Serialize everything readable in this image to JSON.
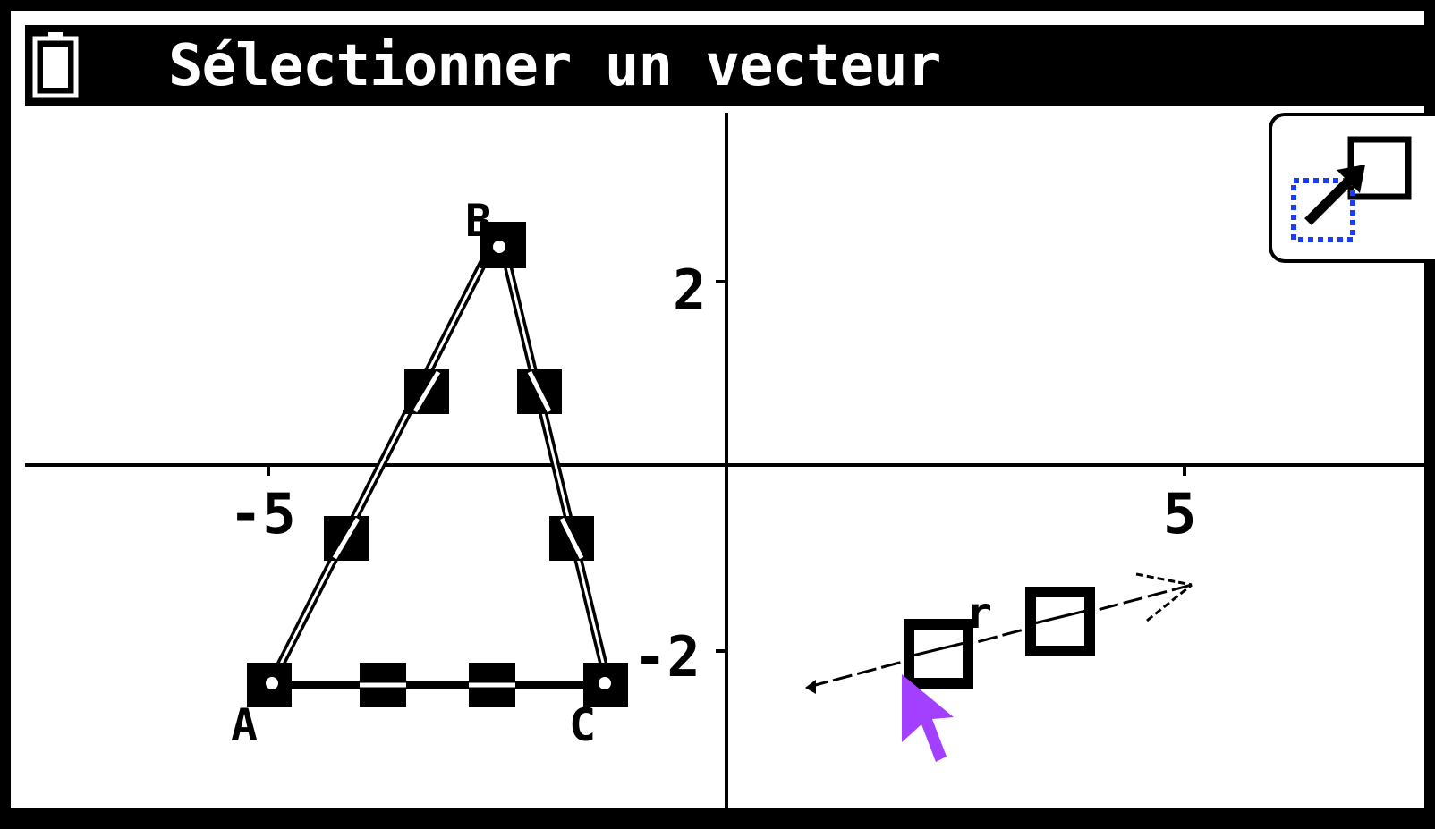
{
  "header": {
    "title": "Sélectionner un vecteur",
    "battery_icon": "battery-icon"
  },
  "graph": {
    "x_tick_labels": [
      "-5",
      "5"
    ],
    "y_tick_labels": [
      "2",
      "-2"
    ],
    "points": {
      "A": {
        "label": "A",
        "x": -5,
        "y": -2.4
      },
      "B": {
        "label": "B",
        "x": -2.6,
        "y": 2.3
      },
      "C": {
        "label": "C",
        "x": -1.3,
        "y": -2.4
      }
    },
    "vector": {
      "start": {
        "x": 1.0,
        "y": -2.4
      },
      "end": {
        "x": 5.1,
        "y": -1.3
      },
      "label": "r"
    },
    "pointer_icon": "cursor-arrow-icon"
  },
  "toolbar": {
    "tool_icon": "vector-tool-icon",
    "accent_color": "#1a3cff",
    "pointer_color": "#a340ff"
  }
}
